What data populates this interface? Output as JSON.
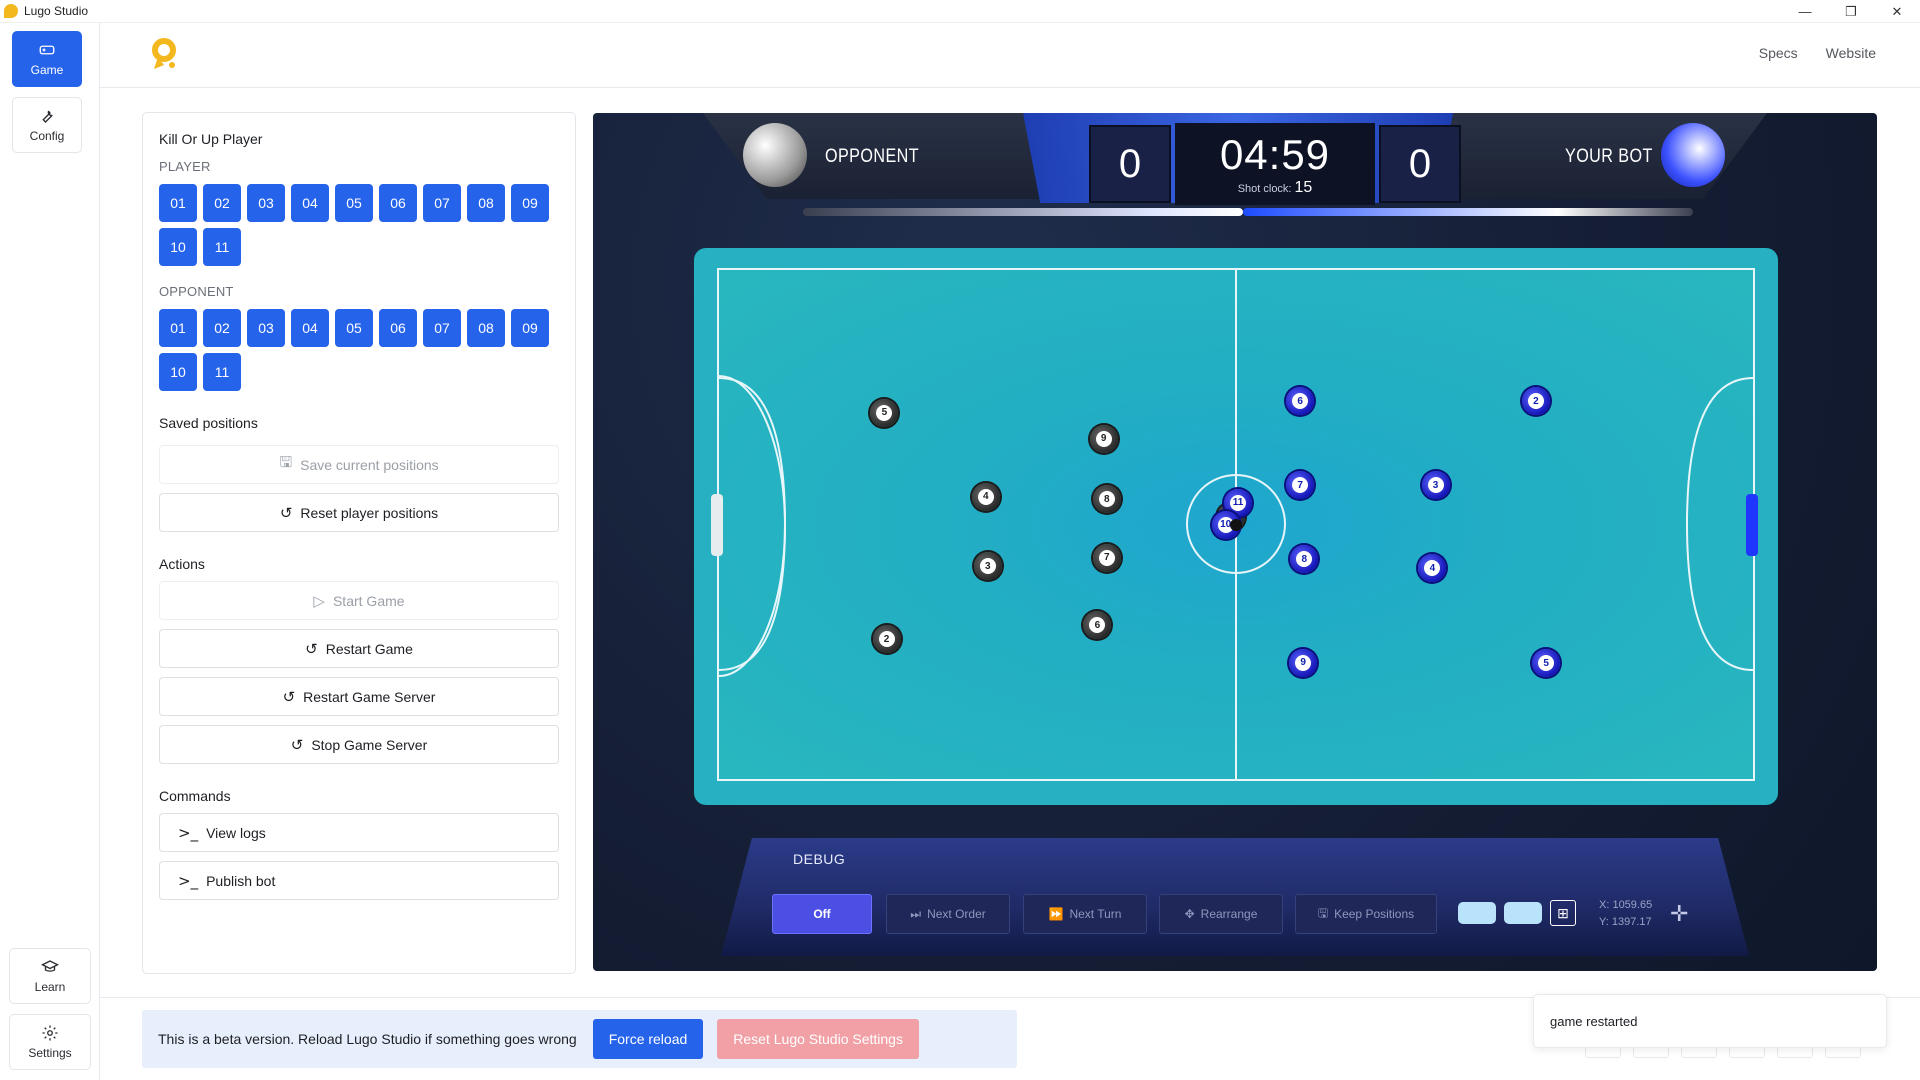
{
  "window": {
    "title": "Lugo Studio",
    "minimize": "—",
    "maximize": "❐",
    "close": "✕"
  },
  "rail": {
    "game_label": "Game",
    "config_label": "Config",
    "learn_label": "Learn",
    "settings_label": "Settings"
  },
  "header": {
    "nav_specs": "Specs",
    "nav_website": "Website"
  },
  "panel": {
    "title": "Kill Or Up Player",
    "player_label": "PLAYER",
    "player_numbers": [
      "01",
      "02",
      "03",
      "04",
      "05",
      "06",
      "07",
      "08",
      "09",
      "10",
      "11"
    ],
    "opponent_label": "OPPONENT",
    "opponent_numbers": [
      "01",
      "02",
      "03",
      "04",
      "05",
      "06",
      "07",
      "08",
      "09",
      "10",
      "11"
    ],
    "saved_positions_label": "Saved positions",
    "save_current": "Save current positions",
    "reset_player": "Reset player positions",
    "actions_label": "Actions",
    "start_game": "Start Game",
    "restart_game": "Restart Game",
    "restart_server": "Restart Game Server",
    "stop_server": "Stop Game Server",
    "commands_label": "Commands",
    "view_logs": "View logs",
    "publish_bot": "Publish bot"
  },
  "game": {
    "opponent_name": "OPPONENT",
    "bot_name": "YOUR BOT",
    "opponent_score": "0",
    "bot_score": "0",
    "clock": "04:59",
    "shot_clock_label": "Shot clock:",
    "shot_clock_value": "15",
    "opponent_players": [
      {
        "n": "5",
        "fx": 0.16,
        "fy": 0.28
      },
      {
        "n": "9",
        "fx": 0.372,
        "fy": 0.332
      },
      {
        "n": "4",
        "fx": 0.258,
        "fy": 0.445
      },
      {
        "n": "8",
        "fx": 0.375,
        "fy": 0.45
      },
      {
        "n": "3",
        "fx": 0.26,
        "fy": 0.582
      },
      {
        "n": "7",
        "fx": 0.375,
        "fy": 0.565
      },
      {
        "n": "2",
        "fx": 0.162,
        "fy": 0.725
      },
      {
        "n": "6",
        "fx": 0.366,
        "fy": 0.698
      },
      {
        "n": "10",
        "fx": 0.495,
        "fy": 0.485
      }
    ],
    "bot_players": [
      {
        "n": "6",
        "fx": 0.562,
        "fy": 0.258
      },
      {
        "n": "2",
        "fx": 0.79,
        "fy": 0.258
      },
      {
        "n": "7",
        "fx": 0.562,
        "fy": 0.423
      },
      {
        "n": "3",
        "fx:": 0,
        "fx": 0.693,
        "fy": 0.423
      },
      {
        "n": "8",
        "fx": 0.566,
        "fy": 0.568
      },
      {
        "n": "4",
        "fx": 0.69,
        "fy": 0.586
      },
      {
        "n": "9",
        "fx": 0.565,
        "fy": 0.772
      },
      {
        "n": "5",
        "fx": 0.8,
        "fy": 0.773
      },
      {
        "n": "11",
        "fx": 0.502,
        "fy": 0.457
      },
      {
        "n": "10",
        "fx": 0.49,
        "fy": 0.5
      }
    ],
    "debug_label": "DEBUG",
    "debug_off": "Off",
    "next_order": "Next Order",
    "next_turn": "Next Turn",
    "rearrange": "Rearrange",
    "keep_positions": "Keep Positions",
    "coord_x": "X:  1059.65",
    "coord_y": "Y:  1397.17",
    "colors": {
      "opponent": "#2a2a2a",
      "bot": "#1616b8",
      "field": "#22aec3",
      "accent": "#2563eb"
    }
  },
  "footer": {
    "beta_message": "This is a beta version. Reload Lugo Studio if something goes wrong",
    "force_reload": "Force reload",
    "reset_settings": "Reset Lugo Studio Settings",
    "toast": "game restarted"
  }
}
